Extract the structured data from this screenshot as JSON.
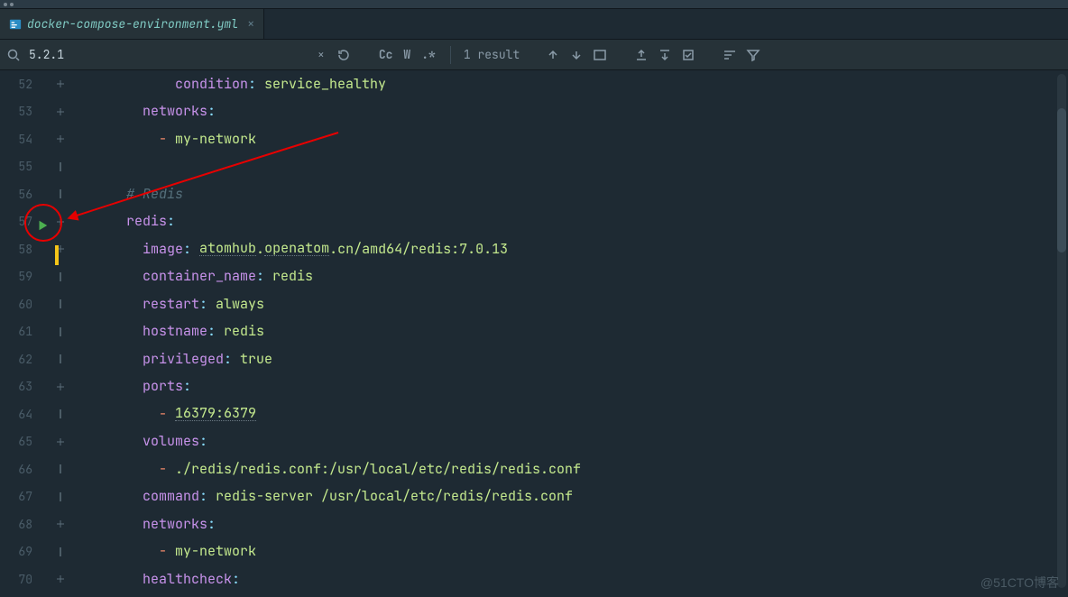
{
  "tab": {
    "filename": "docker-compose-environment.yml",
    "close": "×"
  },
  "find": {
    "query": "5.2.1",
    "close": "×",
    "cc": "Cc",
    "w": "W",
    "regex": ".*",
    "result": "1 result"
  },
  "watermark": "@51CTO博客",
  "lines": [
    {
      "num": "52",
      "indent": 5,
      "tokens": [
        {
          "t": "condition",
          "c": "tok-key"
        },
        {
          "t": ": ",
          "c": "tok-punct"
        },
        {
          "t": "service_healthy",
          "c": "tok-str"
        }
      ]
    },
    {
      "num": "53",
      "indent": 3,
      "tokens": [
        {
          "t": "networks",
          "c": "tok-key"
        },
        {
          "t": ":",
          "c": "tok-punct"
        }
      ]
    },
    {
      "num": "54",
      "indent": 4,
      "tokens": [
        {
          "t": "- ",
          "c": "tok-dash"
        },
        {
          "t": "my-network",
          "c": "tok-str"
        }
      ]
    },
    {
      "num": "55",
      "indent": 0,
      "tokens": []
    },
    {
      "num": "56",
      "indent": 2,
      "tokens": [
        {
          "t": "# Redis",
          "c": "tok-comment"
        }
      ]
    },
    {
      "num": "57",
      "indent": 2,
      "tokens": [
        {
          "t": "redis",
          "c": "tok-key"
        },
        {
          "t": ":",
          "c": "tok-punct"
        }
      ]
    },
    {
      "num": "58",
      "indent": 3,
      "tokens": [
        {
          "t": "image",
          "c": "tok-key"
        },
        {
          "t": ": ",
          "c": "tok-punct"
        },
        {
          "t": "atomhub",
          "c": "tok-str underline-dotted"
        },
        {
          "t": ".",
          "c": "tok-str"
        },
        {
          "t": "openatom",
          "c": "tok-str underline-dotted"
        },
        {
          "t": ".cn/amd64/redis:7.0.13",
          "c": "tok-str"
        }
      ]
    },
    {
      "num": "59",
      "indent": 3,
      "tokens": [
        {
          "t": "container_name",
          "c": "tok-key"
        },
        {
          "t": ": ",
          "c": "tok-punct"
        },
        {
          "t": "redis",
          "c": "tok-str"
        }
      ]
    },
    {
      "num": "60",
      "indent": 3,
      "tokens": [
        {
          "t": "restart",
          "c": "tok-key"
        },
        {
          "t": ": ",
          "c": "tok-punct"
        },
        {
          "t": "always",
          "c": "tok-str"
        }
      ]
    },
    {
      "num": "61",
      "indent": 3,
      "tokens": [
        {
          "t": "hostname",
          "c": "tok-key"
        },
        {
          "t": ": ",
          "c": "tok-punct"
        },
        {
          "t": "redis",
          "c": "tok-str"
        }
      ]
    },
    {
      "num": "62",
      "indent": 3,
      "tokens": [
        {
          "t": "privileged",
          "c": "tok-key"
        },
        {
          "t": ": ",
          "c": "tok-punct"
        },
        {
          "t": "true",
          "c": "tok-str"
        }
      ]
    },
    {
      "num": "63",
      "indent": 3,
      "tokens": [
        {
          "t": "ports",
          "c": "tok-key"
        },
        {
          "t": ":",
          "c": "tok-punct"
        }
      ]
    },
    {
      "num": "64",
      "indent": 4,
      "tokens": [
        {
          "t": "- ",
          "c": "tok-dash"
        },
        {
          "t": "16379:6379",
          "c": "tok-str underline-dotted"
        }
      ]
    },
    {
      "num": "65",
      "indent": 3,
      "tokens": [
        {
          "t": "volumes",
          "c": "tok-key"
        },
        {
          "t": ":",
          "c": "tok-punct"
        }
      ]
    },
    {
      "num": "66",
      "indent": 4,
      "tokens": [
        {
          "t": "- ",
          "c": "tok-dash"
        },
        {
          "t": "./redis/redis.conf:/usr/local/etc/redis/redis.conf",
          "c": "tok-str"
        }
      ]
    },
    {
      "num": "67",
      "indent": 3,
      "tokens": [
        {
          "t": "command",
          "c": "tok-key"
        },
        {
          "t": ": ",
          "c": "tok-punct"
        },
        {
          "t": "redis-server /usr/local/etc/redis/redis.conf",
          "c": "tok-str"
        }
      ]
    },
    {
      "num": "68",
      "indent": 3,
      "tokens": [
        {
          "t": "networks",
          "c": "tok-key"
        },
        {
          "t": ":",
          "c": "tok-punct"
        }
      ]
    },
    {
      "num": "69",
      "indent": 4,
      "tokens": [
        {
          "t": "- ",
          "c": "tok-dash"
        },
        {
          "t": "my-network",
          "c": "tok-str"
        }
      ]
    },
    {
      "num": "70",
      "indent": 3,
      "tokens": [
        {
          "t": "healthcheck",
          "c": "tok-key"
        },
        {
          "t": ":",
          "c": "tok-punct"
        }
      ]
    }
  ]
}
